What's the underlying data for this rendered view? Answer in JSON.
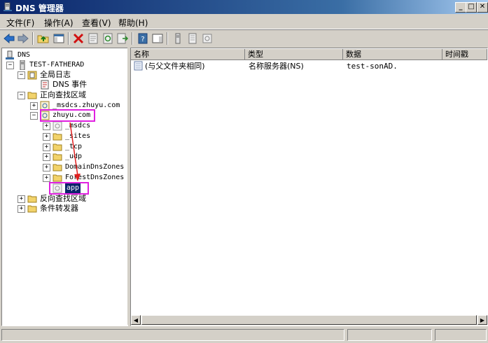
{
  "window": {
    "title": "DNS 管理器",
    "min": "_",
    "max": "□",
    "close": "✕"
  },
  "menu": {
    "file": "文件(F)",
    "action": "操作(A)",
    "view": "查看(V)",
    "help": "帮助(H)"
  },
  "tree": {
    "root": "DNS",
    "server": "TEST-FATHERAD",
    "global_logs": "全局日志",
    "dns_events": "DNS 事件",
    "forward_zones": "正向查找区域",
    "msdcs_zone": "_msdcs.zhuyu.com",
    "zhuyu_zone": "zhuyu.com",
    "sub_msdcs": "_msdcs",
    "sub_sites": "_sites",
    "sub_tcp": "_tcp",
    "sub_udp": "_udp",
    "domain_dns_zones": "DomainDnsZones",
    "forest_dns_zones": "ForestDnsZones",
    "app": "app",
    "reverse_zones": "反向查找区域",
    "conditional_forwarders": "条件转发器"
  },
  "list": {
    "columns": [
      "名称",
      "类型",
      "数据",
      "时间戳"
    ],
    "rows": [
      {
        "name": "(与父文件夹相同)",
        "type": "名称服务器(NS)",
        "data": "test-sonAD."
      }
    ]
  },
  "colors": {
    "highlight": "#e020e0",
    "arrow": "#e02020",
    "selection": "#0a246a"
  }
}
